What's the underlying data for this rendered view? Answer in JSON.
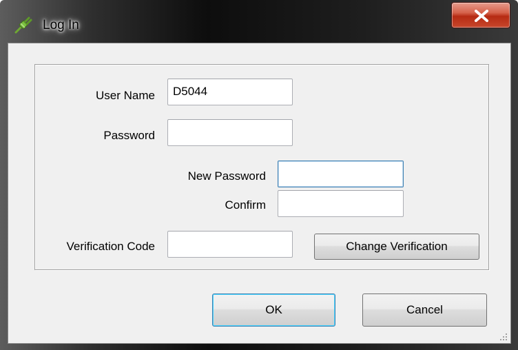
{
  "window": {
    "title": "Log In"
  },
  "form": {
    "username_label": "User Name",
    "username_value": "D5044",
    "password_label": "Password",
    "password_value": "",
    "new_password_label": "New Password",
    "new_password_value": "",
    "confirm_label": "Confirm",
    "confirm_value": "",
    "verification_label": "Verification Code",
    "verification_value": "",
    "change_verification_label": "Change Verification"
  },
  "actions": {
    "ok_label": "OK",
    "cancel_label": "Cancel"
  },
  "icons": {
    "app": "plug-icon",
    "close": "close-icon",
    "grip": "resize-grip-icon"
  },
  "colors": {
    "close_button": "#c8472c",
    "focus_border": "#3c7fb1",
    "dialog_background": "#f0f0f0"
  }
}
